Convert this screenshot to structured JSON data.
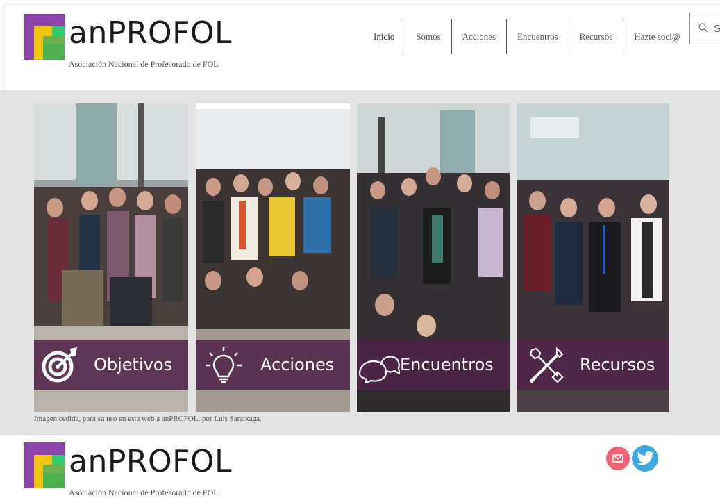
{
  "header": {
    "logo_name": "anPROFOL",
    "logo_subtitle": "Asociación Nacional de Profesorado de FOL",
    "nav": [
      "Inicio",
      "Somos",
      "Acciones",
      "Encuentros",
      "Recursos",
      "Hazte soci@"
    ],
    "search": {
      "value": "S",
      "icon": "search-icon"
    }
  },
  "hero": {
    "panels": [
      {
        "label": "Objetivos",
        "icon": "target-icon"
      },
      {
        "label": "Acciones",
        "icon": "lightbulb-icon"
      },
      {
        "label": "Encuentros",
        "icon": "chat-bubbles-icon"
      },
      {
        "label": "Recursos",
        "icon": "tools-icon"
      }
    ],
    "caption": "Imagen cedida, para su uso en esta web a anPROFOL, por Luis Saratxaga."
  },
  "footer": {
    "logo_name": "anPROFOL",
    "logo_subtitle": "Asociación Nacional de Profesorado de FOL",
    "social": [
      "mail-icon",
      "twitter-icon"
    ]
  },
  "colors": {
    "banner": "#50244a",
    "hero_background": "#e3e3e3",
    "mail": "#f06275",
    "twitter": "#3ea6e0"
  }
}
